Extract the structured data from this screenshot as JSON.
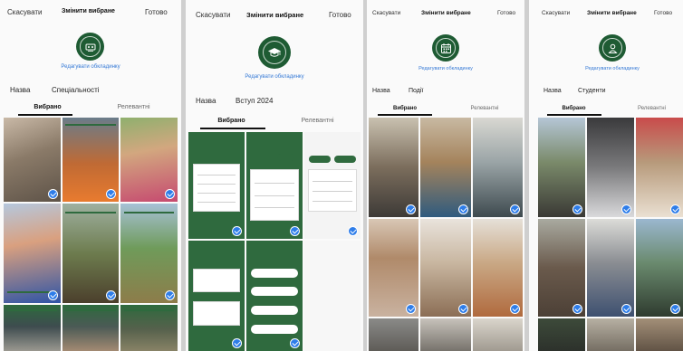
{
  "common": {
    "cancel_label": "Скасувати",
    "change_selected_label": "Змінити вибране",
    "done_label": "Готово",
    "edit_cover_label": "Редагувати обкладинку",
    "name_label": "Назва",
    "tab_selected": "Вибрано",
    "tab_recommendations": "Релевантні"
  },
  "panels": [
    {
      "name_value": "Спеціальності",
      "cover_icon": "people-grid-icon"
    },
    {
      "name_value": "Вступ 2024",
      "cover_icon": "graduation-cap-icon"
    },
    {
      "name_value": "Події",
      "cover_icon": "calendar-icon"
    },
    {
      "name_value": "Студенти",
      "cover_icon": "person-icon"
    }
  ],
  "colors": {
    "accent_green": "#1e5b33",
    "link_blue": "#3579d6",
    "check_blue": "#2e7de9"
  }
}
